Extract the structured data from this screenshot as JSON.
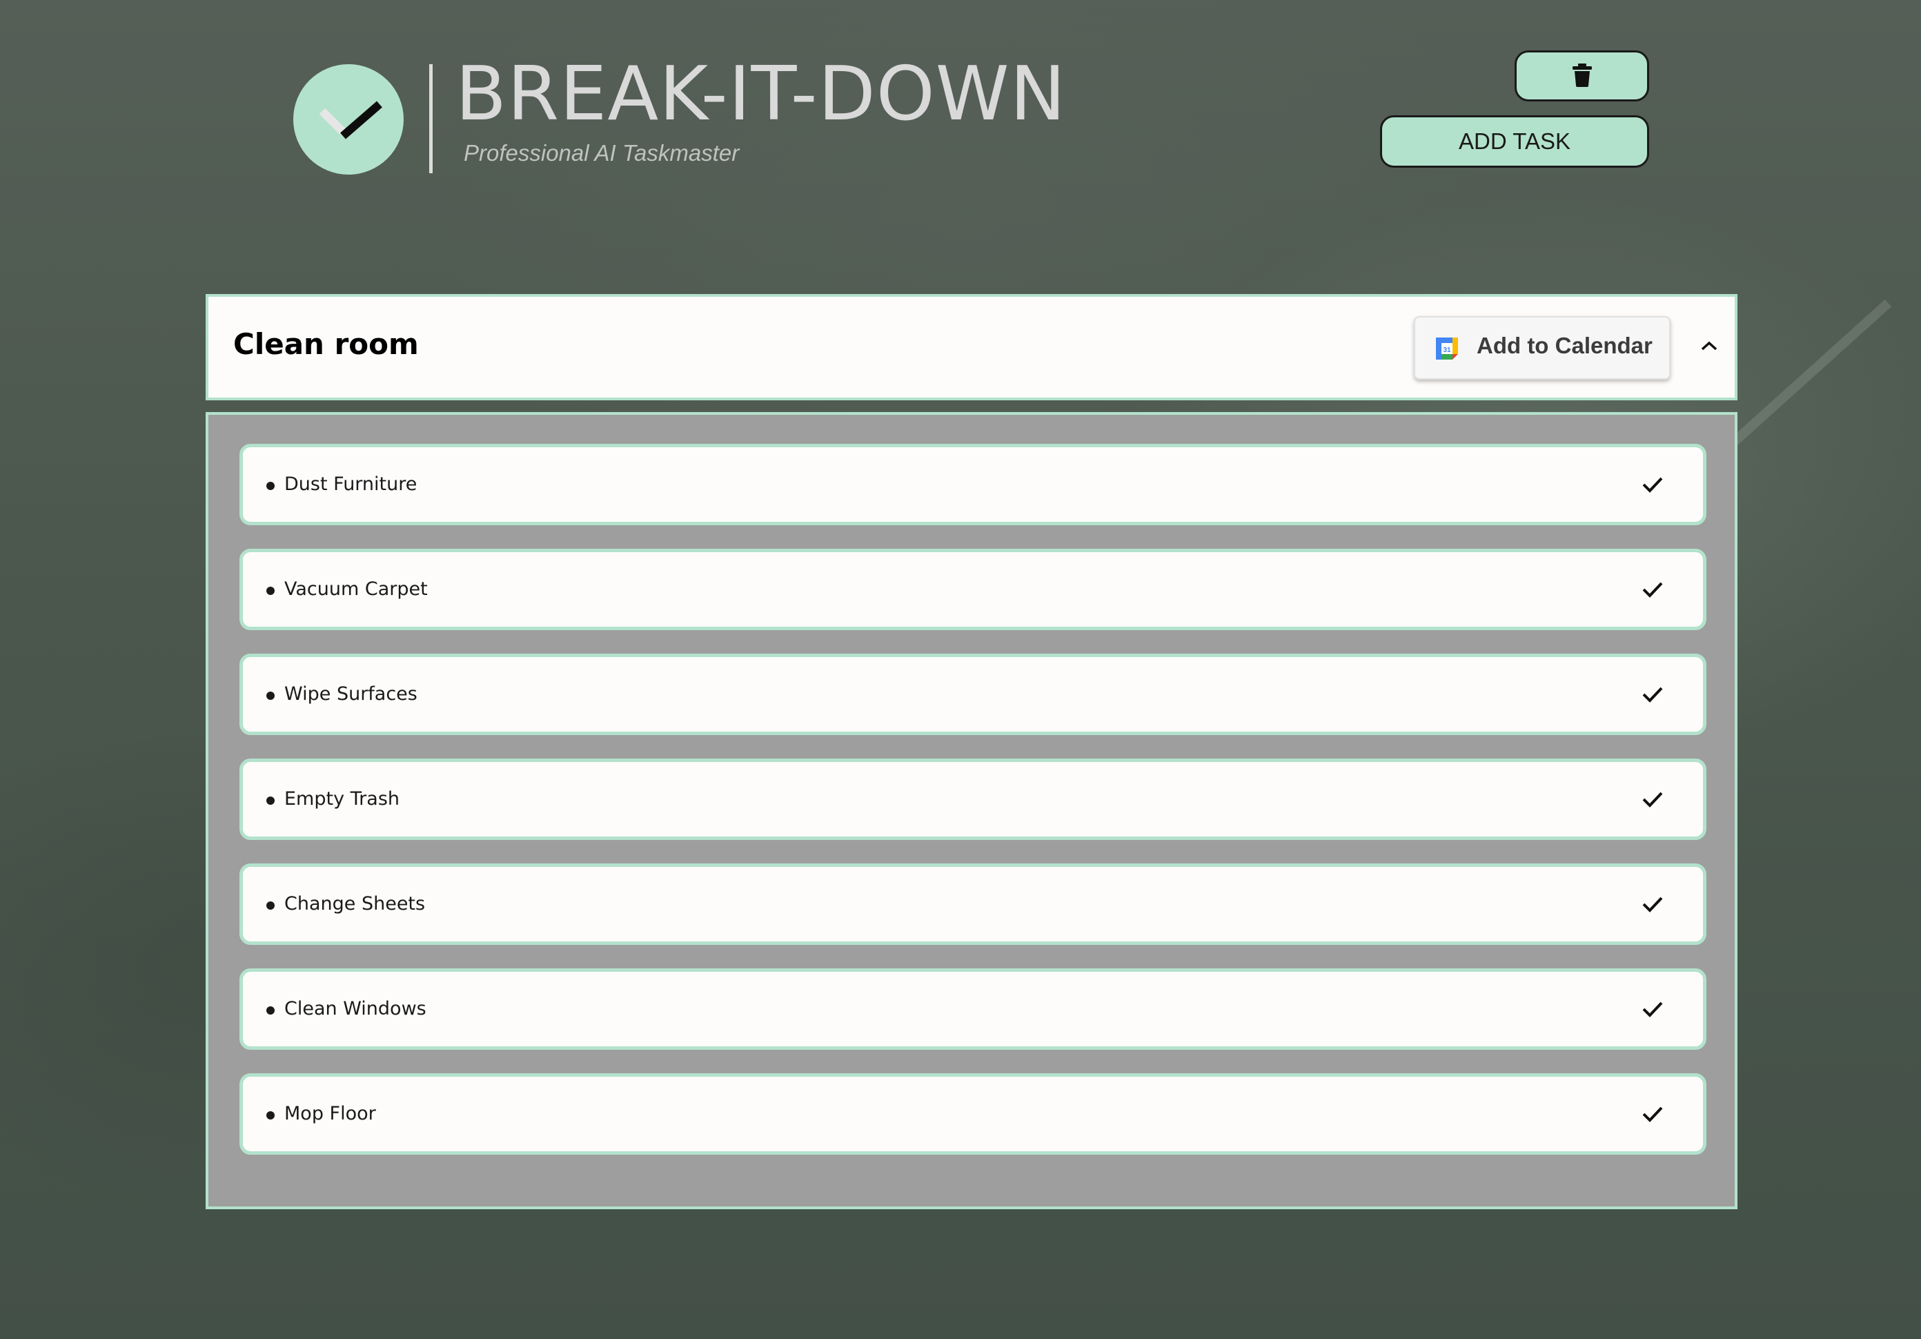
{
  "app": {
    "brand_title": "BREAK-IT-DOWN",
    "brand_subtitle": "Professional AI Taskmaster"
  },
  "header": {
    "delete_icon": "trash-icon",
    "add_task_label": "ADD TASK"
  },
  "task": {
    "title": "Clean room",
    "calendar_label": "Add to Calendar",
    "calendar_icon": "google-calendar-icon",
    "collapse_icon": "chevron-up-icon",
    "subtasks": [
      {
        "label": "Dust Furniture"
      },
      {
        "label": "Vacuum Carpet"
      },
      {
        "label": "Wipe Surfaces"
      },
      {
        "label": "Empty Trash"
      },
      {
        "label": "Change Sheets"
      },
      {
        "label": "Clean Windows"
      },
      {
        "label": "Mop Floor"
      }
    ]
  },
  "colors": {
    "accent_mint": "#b3e2cc",
    "panel_gray": "#9e9e9e",
    "card_white": "#fdfcfa",
    "background": "#4d5a4f"
  }
}
